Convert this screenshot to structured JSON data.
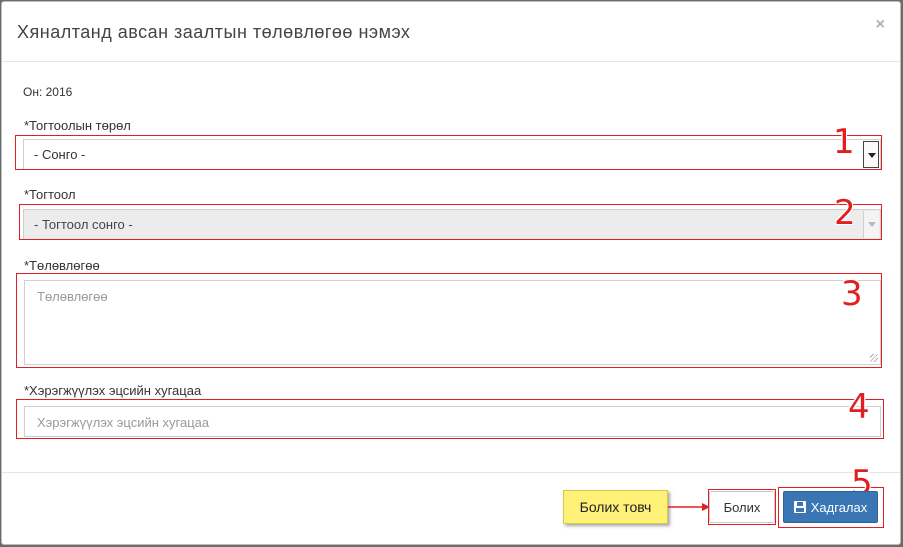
{
  "modal": {
    "title": "Хяналтанд авсан заалтын төлөвлөгөө нэмэх",
    "close_symbol": "×"
  },
  "year_label": "Он: 2016",
  "form": {
    "resolution_type": {
      "label": "*Тогтоолын төрөл",
      "value": "- Сонго -"
    },
    "resolution": {
      "label": "*Тогтоол",
      "value": "- Тогтоол сонго -",
      "disabled": true
    },
    "plan": {
      "label": "*Төлөвлөгөө",
      "placeholder": "Төлөвлөгөө"
    },
    "deadline": {
      "label": "*Хэрэгжүүлэх эцсийн хугацаа",
      "placeholder": "Хэрэгжүүлэх эцсийн хугацаа"
    }
  },
  "annotations": [
    "1",
    "2",
    "3",
    "4",
    "5"
  ],
  "callout": "Болих товч",
  "footer": {
    "cancel_label": "Болих",
    "save_label": "Хадгалах",
    "save_icon": "floppy-disk-icon"
  },
  "colors": {
    "annotation": "#e02020",
    "primary_button": "#3a76b4",
    "callout_bg": "#fff078"
  }
}
